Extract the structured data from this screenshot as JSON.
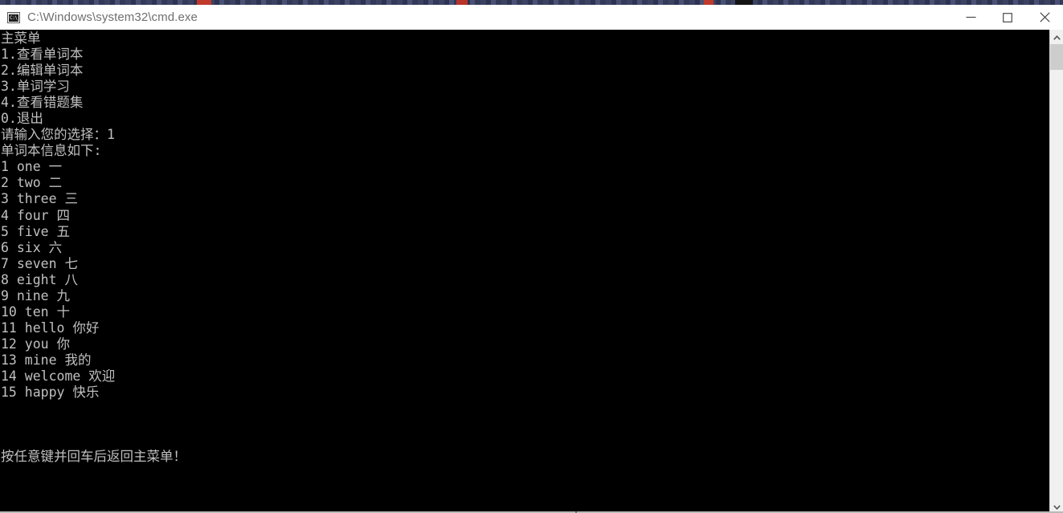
{
  "background_window": {
    "description_visible": false
  },
  "titlebar": {
    "icon": "cmd-console-icon",
    "icon_glyph": "C:\\_",
    "title": "C:\\Windows\\system32\\cmd.exe",
    "controls": {
      "minimize": "minimize",
      "maximize": "maximize",
      "close": "close"
    }
  },
  "console": {
    "foreground_color": "#c0c0c0",
    "background_color": "#000000",
    "lines": [
      "主菜单",
      "1.查看单词本",
      "2.编辑单词本",
      "3.单词学习",
      "4.查看错题集",
      "0.退出",
      "请输入您的选择：1",
      "单词本信息如下:",
      "1 one 一",
      "2 two 二",
      "3 three 三",
      "4 four 四",
      "5 five 五",
      "6 six 六",
      "7 seven 七",
      "8 eight 八",
      "9 nine 九",
      "10 ten 十",
      "11 hello 你好",
      "12 you 你",
      "13 mine 我的",
      "14 welcome 欢迎",
      "15 happy 快乐",
      "",
      "",
      "",
      "按任意键并回车后返回主菜单！"
    ],
    "menu": {
      "title": "主菜单",
      "options": [
        {
          "key": "1",
          "label": "1.查看单词本"
        },
        {
          "key": "2",
          "label": "2.编辑单词本"
        },
        {
          "key": "3",
          "label": "3.单词学习"
        },
        {
          "key": "4",
          "label": "4.查看错题集"
        },
        {
          "key": "0",
          "label": "0.退出"
        }
      ],
      "prompt": "请输入您的选择：",
      "entered_choice": "1"
    },
    "wordlist": {
      "heading": "单词本信息如下:",
      "entries": [
        {
          "index": "1",
          "word": "one",
          "meaning": "一"
        },
        {
          "index": "2",
          "word": "two",
          "meaning": "二"
        },
        {
          "index": "3",
          "word": "three",
          "meaning": "三"
        },
        {
          "index": "4",
          "word": "four",
          "meaning": "四"
        },
        {
          "index": "5",
          "word": "five",
          "meaning": "五"
        },
        {
          "index": "6",
          "word": "six",
          "meaning": "六"
        },
        {
          "index": "7",
          "word": "seven",
          "meaning": "七"
        },
        {
          "index": "8",
          "word": "eight",
          "meaning": "八"
        },
        {
          "index": "9",
          "word": "nine",
          "meaning": "九"
        },
        {
          "index": "10",
          "word": "ten",
          "meaning": "十"
        },
        {
          "index": "11",
          "word": "hello",
          "meaning": "你好"
        },
        {
          "index": "12",
          "word": "you",
          "meaning": "你"
        },
        {
          "index": "13",
          "word": "mine",
          "meaning": "我的"
        },
        {
          "index": "14",
          "word": "welcome",
          "meaning": "欢迎"
        },
        {
          "index": "15",
          "word": "happy",
          "meaning": "快乐"
        }
      ]
    },
    "footer_prompt": "按任意键并回车后返回主菜单！"
  },
  "scrollbar": {
    "up_arrow": "chevron-up-icon",
    "down_arrow": "chevron-down-icon",
    "thumb": "scrollbar-thumb"
  }
}
